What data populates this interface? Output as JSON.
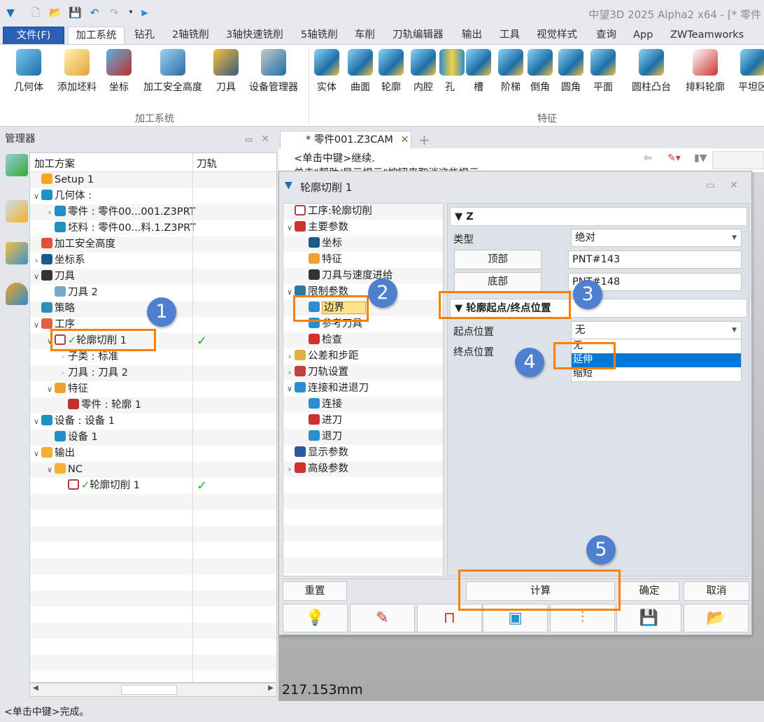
{
  "titlebar": {
    "app_title": "中望3D 2025 Alpha2 x64 - [* 零件"
  },
  "menu": {
    "file": "文件(F)",
    "tabs": [
      "加工系统",
      "钻孔",
      "2轴铣削",
      "3轴快速铣削",
      "5轴铣削",
      "车削",
      "刀轨编辑器",
      "输出",
      "工具",
      "视觉样式",
      "查询",
      "App",
      "ZWTeamworks"
    ]
  },
  "ribbon": {
    "group1": {
      "label": "加工系统",
      "buttons": [
        "几何体",
        "添加坯料",
        "坐标",
        "加工安全高度",
        "刀具",
        "设备管理器"
      ]
    },
    "group2": {
      "label": "特征",
      "buttons": [
        "实体",
        "曲面",
        "轮廓",
        "内腔",
        "孔",
        "槽",
        "阶梯",
        "倒角",
        "圆角",
        "平面",
        "圆柱凸台",
        "排料轮廓",
        "平坦区"
      ]
    }
  },
  "manager": {
    "title": "管理器",
    "columns": [
      "加工方案",
      "刀轨"
    ],
    "rows": [
      {
        "label": "Setup 1",
        "level": 0,
        "chev": "",
        "icon": "folder-icon",
        "color": "#f4a81d"
      },
      {
        "label": "几何体 :",
        "level": 0,
        "chev": "open",
        "icon": "geometry-icon",
        "color": "#1f8fc4"
      },
      {
        "label": "零件 : 零件00...001.Z3PRT",
        "level": 1,
        "chev": "closed",
        "icon": "part-icon",
        "color": "#1f8fc4"
      },
      {
        "label": "坯料 : 零件00...料.1.Z3PRT",
        "level": 1,
        "chev": "",
        "icon": "stock-icon",
        "color": "#1f8fc4"
      },
      {
        "label": "加工安全高度",
        "level": 0,
        "chev": "",
        "icon": "safe-height-icon",
        "color": "#e0503a"
      },
      {
        "label": "坐标系",
        "level": 0,
        "chev": "closed",
        "icon": "coordinate-icon",
        "color": "#1a5a8a"
      },
      {
        "label": "刀具",
        "level": 0,
        "chev": "open",
        "icon": "tools-icon",
        "color": "#333333"
      },
      {
        "label": "刀具 2",
        "level": 1,
        "chev": "",
        "icon": "tool-icon",
        "color": "#7aa8c8"
      },
      {
        "label": "策略",
        "level": 0,
        "chev": "",
        "icon": "strategy-icon",
        "color": "#2a8fb0"
      },
      {
        "label": "工序",
        "level": 0,
        "chev": "open",
        "icon": "operation-icon",
        "color": "#e06040"
      },
      {
        "label": "轮廓切削 1",
        "level": 1,
        "chev": "open",
        "icon": "op-check-icon",
        "color": "#ffffff",
        "check": true
      },
      {
        "label": "子类 : 标准",
        "level": 2,
        "chev": "dot",
        "icon": "",
        "color": ""
      },
      {
        "label": "刀具 : 刀具 2",
        "level": 2,
        "chev": "dot",
        "icon": "",
        "color": ""
      },
      {
        "label": "特征",
        "level": 2,
        "chev": "open",
        "icon": "feature-icon",
        "color": "#f0a030",
        "shift": -1
      },
      {
        "label": "零件 : 轮廓 1",
        "level": 3,
        "chev": "",
        "icon": "profile-icon",
        "color": "#c03030",
        "shift": -1
      },
      {
        "label": "设备 : 设备 1",
        "level": 0,
        "chev": "open",
        "icon": "equipment-icon",
        "color": "#1f8fc4"
      },
      {
        "label": "设备 1",
        "level": 1,
        "chev": "",
        "icon": "equipment-icon",
        "color": "#1f8fc4"
      },
      {
        "label": "输出",
        "level": 0,
        "chev": "open",
        "icon": "output-icon",
        "color": "#f4b030"
      },
      {
        "label": "NC",
        "level": 1,
        "chev": "open",
        "icon": "nc-icon",
        "color": "#f4b030"
      },
      {
        "label": "轮廓切削 1",
        "level": 2,
        "chev": "",
        "icon": "op-check-icon",
        "color": "#ffffff",
        "check": true
      }
    ],
    "check_mark": "✓"
  },
  "status": "<单击中键>完成。",
  "document": {
    "tab": "* 零件001.Z3CAM",
    "close": "✕",
    "add": "+",
    "hint_line1": "<单击中键>继续.",
    "hint_line2": "单击\"帮助/显示提示\"按钮来取消这些提示",
    "measure": "217.153mm"
  },
  "dialog": {
    "title": "轮廓切削 1",
    "tree": [
      {
        "label": "工序:轮廓切削",
        "level": 0,
        "chev": "",
        "icon": "operation-box-icon",
        "color": "#ffffff"
      },
      {
        "label": "主要参数",
        "level": 0,
        "chev": "open",
        "icon": "main-params-icon",
        "color": "#d03030"
      },
      {
        "label": "坐标",
        "level": 1,
        "chev": "",
        "icon": "coordinate-icon",
        "color": "#1a5a8a"
      },
      {
        "label": "特征",
        "level": 1,
        "chev": "",
        "icon": "feature-icon",
        "color": "#f0a030"
      },
      {
        "label": "刀具与速度进给",
        "level": 1,
        "chev": "",
        "icon": "tools-icon",
        "color": "#333333"
      },
      {
        "label": "限制参数",
        "level": 0,
        "chev": "open",
        "icon": "limit-params-icon",
        "color": "#2a7aa0"
      },
      {
        "label": "边界",
        "level": 1,
        "chev": "",
        "icon": "boundary-icon",
        "color": "#2a8fd0",
        "selected": true
      },
      {
        "label": "参考刀具",
        "level": 1,
        "chev": "",
        "icon": "reference-tool-icon",
        "color": "#2a8fd0"
      },
      {
        "label": "检查",
        "level": 1,
        "chev": "",
        "icon": "check-icon",
        "color": "#d03030"
      },
      {
        "label": "公差和步距",
        "level": 0,
        "chev": "closed",
        "icon": "tolerance-icon",
        "color": "#e0b040"
      },
      {
        "label": "刀轨设置",
        "level": 0,
        "chev": "closed",
        "icon": "toolpath-settings-icon",
        "color": "#c04040"
      },
      {
        "label": "连接和进退刀",
        "level": 0,
        "chev": "open",
        "icon": "link-icon",
        "color": "#2a8fd0"
      },
      {
        "label": "连接",
        "level": 1,
        "chev": "",
        "icon": "connect-icon",
        "color": "#2a8fd0"
      },
      {
        "label": "进刀",
        "level": 1,
        "chev": "",
        "icon": "lead-in-icon",
        "color": "#d03030"
      },
      {
        "label": "退刀",
        "level": 1,
        "chev": "",
        "icon": "lead-out-icon",
        "color": "#2a8fd0"
      },
      {
        "label": "显示参数",
        "level": 0,
        "chev": "",
        "icon": "display-params-icon",
        "color": "#2a5a9a"
      },
      {
        "label": "高级参数",
        "level": 0,
        "chev": "closed",
        "icon": "advanced-params-icon",
        "color": "#d03030"
      }
    ],
    "section_z": "Z",
    "type_label": "类型",
    "type_value": "绝对",
    "top_button": "顶部",
    "top_value": "PNT#143",
    "bottom_button": "底部",
    "bottom_value": "PNT#148",
    "section_pos": "轮廓起点/终点位置",
    "start_label": "起点位置",
    "start_value": "无",
    "end_label": "终点位置",
    "options": [
      "无",
      "延伸",
      "缩短"
    ],
    "selected_option": "延伸",
    "reset": "重置",
    "compute": "计算",
    "ok": "确定",
    "cancel": "取消"
  },
  "annotations": [
    "1",
    "2",
    "3",
    "4",
    "5"
  ],
  "colors": {
    "accent_orange": "#ff8000",
    "badge_blue": "#4f7fcf",
    "selection_blue": "#0078d7",
    "file_tab": "#2b5fb3"
  }
}
